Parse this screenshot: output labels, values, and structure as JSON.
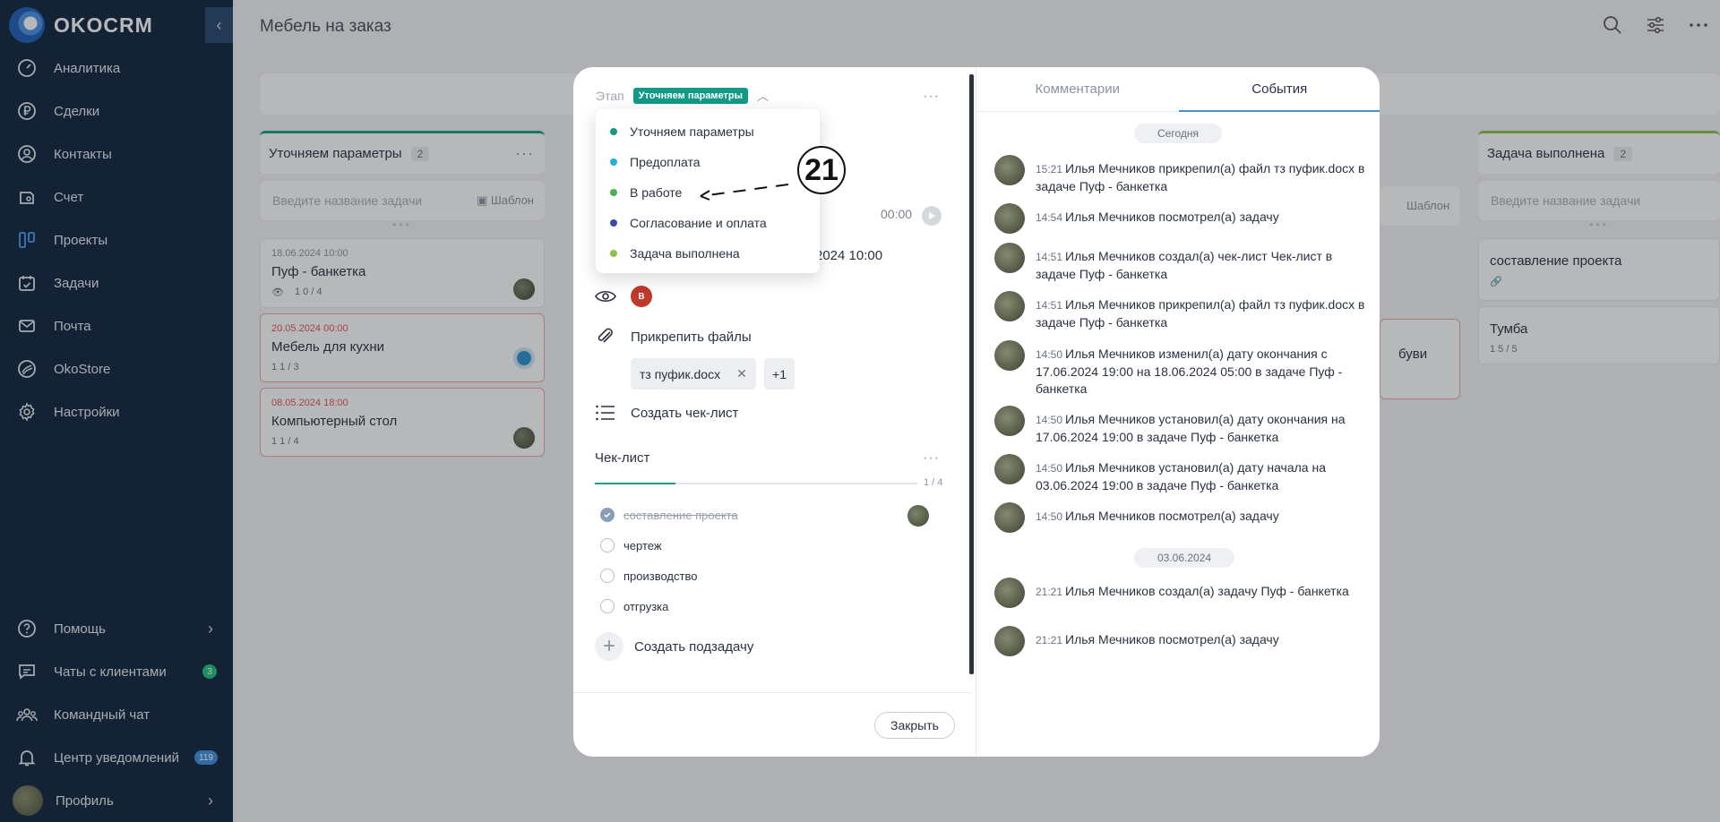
{
  "app": {
    "brand": "OKOCRM",
    "collapse_glyph": "‹"
  },
  "sidebar": {
    "items": [
      {
        "label": "Аналитика",
        "icon": "gauge-icon"
      },
      {
        "label": "Сделки",
        "icon": "ruble-icon"
      },
      {
        "label": "Контакты",
        "icon": "user-icon"
      },
      {
        "label": "Счет",
        "icon": "invoice-icon"
      },
      {
        "label": "Проекты",
        "icon": "kanban-icon"
      },
      {
        "label": "Задачи",
        "icon": "calendar-check-icon"
      },
      {
        "label": "Почта",
        "icon": "mail-icon"
      },
      {
        "label": "OkoStore",
        "icon": "store-icon"
      },
      {
        "label": "Настройки",
        "icon": "gear-icon"
      }
    ],
    "bottom": {
      "help": "Помощь",
      "chats": "Чаты с клиентами",
      "chats_badge": "3",
      "team": "Командный чат",
      "notifications": "Центр уведомлений",
      "notifications_badge": "119",
      "profile": "Профиль"
    }
  },
  "board": {
    "title": "Мебель на заказ",
    "columns": [
      {
        "name": "Уточняем параметры",
        "count": "2",
        "color": "#1b9e8a"
      },
      {
        "name": "Задача выполнена",
        "count": "2",
        "color": "#8bc34a"
      }
    ],
    "add_placeholder": "Введите название задачи",
    "template_label": "Шаблон",
    "cards_col1": [
      {
        "date": "18.06.2024 10:00",
        "name": "Пуф - банкетка",
        "meta": "1    0 / 4"
      },
      {
        "date": "20.05.2024 00:00",
        "name": "Мебель для кухни",
        "meta": "1    1 / 3"
      },
      {
        "date": "08.05.2024 18:00",
        "name": "Компьютерный стол",
        "meta": "1    1 / 4"
      }
    ],
    "cards_last": [
      {
        "name": "составление проекта"
      },
      {
        "name": "Тумба",
        "meta": "1    5 / 5"
      }
    ],
    "partial_text": "буви"
  },
  "modal": {
    "stage_label": "Этап",
    "stage_value": "Уточняем параметры",
    "stage_options": [
      {
        "label": "Уточняем параметры",
        "color": "#129a86"
      },
      {
        "label": "Предоплата",
        "color": "#1fb3d9"
      },
      {
        "label": "В работе",
        "color": "#4caf50"
      },
      {
        "label": "Согласование и оплата",
        "color": "#3949ab"
      },
      {
        "label": "Задача выполнена",
        "color": "#8bc34a"
      }
    ],
    "timer": "00:00",
    "deadline_tail": "2024 10:00",
    "watcher_initial": "В",
    "attach_label": "Прикрепить файлы",
    "file_name": "тз пуфик.docx",
    "file_more": "+1",
    "create_checklist": "Создать чек-лист",
    "checklist_title": "Чек-лист",
    "checklist_count": "1 / 4",
    "checklist_progress": 0.25,
    "checklist_items": [
      {
        "text": "составление проекта",
        "done": true
      },
      {
        "text": "чертеж",
        "done": false
      },
      {
        "text": "производство",
        "done": false
      },
      {
        "text": "отгрузка",
        "done": false
      }
    ],
    "create_subtask": "Создать подзадачу",
    "close_label": "Закрыть"
  },
  "annotation": {
    "number": "21"
  },
  "events": {
    "tabs": [
      "Комментарии",
      "События"
    ],
    "active_tab": "События",
    "today_label": "Сегодня",
    "date_label": "03.06.2024",
    "list": [
      {
        "time": "15:21",
        "text": "Илья Мечников прикрепил(а) файл тз пуфик.docx в задаче Пуф - банкетка"
      },
      {
        "time": "14:54",
        "text": "Илья Мечников посмотрел(а) задачу"
      },
      {
        "time": "14:51",
        "text": "Илья Мечников создал(а) чек-лист Чек-лист в задаче Пуф - банкетка"
      },
      {
        "time": "14:51",
        "text": "Илья Мечников прикрепил(а) файл тз пуфик.docx в задаче Пуф - банкетка"
      },
      {
        "time": "14:50",
        "text": "Илья Мечников изменил(а) дату окончания с 17.06.2024 19:00 на 18.06.2024 05:00 в задаче Пуф - банкетка"
      },
      {
        "time": "14:50",
        "text": "Илья Мечников установил(а) дату окончания на 17.06.2024 19:00 в задаче Пуф - банкетка"
      },
      {
        "time": "14:50",
        "text": "Илья Мечников установил(а) дату начала на 03.06.2024 19:00 в задаче Пуф - банкетка"
      },
      {
        "time": "14:50",
        "text": "Илья Мечников посмотрел(а) задачу"
      },
      {
        "time": "21:21",
        "text": "Илья Мечников создал(а) задачу Пуф - банкетка"
      },
      {
        "time": "21:21",
        "text": "Илья Мечников посмотрел(а) задачу"
      }
    ]
  }
}
